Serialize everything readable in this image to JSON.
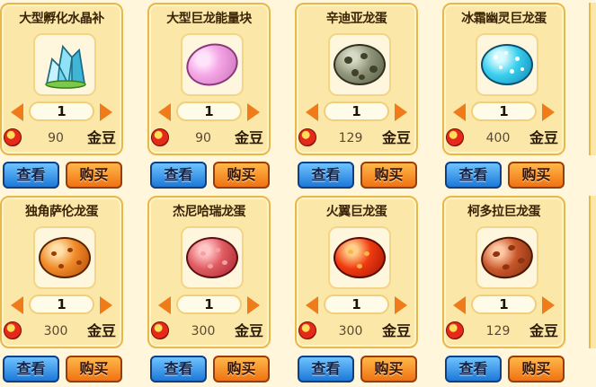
{
  "items": [
    {
      "name": "大型孵化水晶补",
      "qty": "1",
      "price": "90",
      "currency": "金豆",
      "view_label": "查看",
      "buy_label": "购买",
      "icon": "crystal-icon",
      "color": "#69d3e8"
    },
    {
      "name": "大型巨龙能量块",
      "qty": "1",
      "price": "90",
      "currency": "金豆",
      "view_label": "查看",
      "buy_label": "购买",
      "icon": "pink-energy-stone-icon",
      "color": "#f5a7e6"
    },
    {
      "name": "辛迪亚龙蛋",
      "qty": "1",
      "price": "129",
      "currency": "金豆",
      "view_label": "查看",
      "buy_label": "购买",
      "icon": "gray-spotted-egg-icon",
      "color": "#8f9479"
    },
    {
      "name": "冰霜幽灵巨龙蛋",
      "qty": "1",
      "price": "400",
      "currency": "金豆",
      "view_label": "查看",
      "buy_label": "购买",
      "icon": "cyan-spotted-egg-icon",
      "color": "#39cfee"
    },
    {
      "name": "独角萨伦龙蛋",
      "qty": "1",
      "price": "300",
      "currency": "金豆",
      "view_label": "查看",
      "buy_label": "购买",
      "icon": "orange-spotted-egg-icon",
      "color": "#f08a28"
    },
    {
      "name": "杰尼哈瑞龙蛋",
      "qty": "1",
      "price": "300",
      "currency": "金豆",
      "view_label": "查看",
      "buy_label": "购买",
      "icon": "red-spotted-egg-icon",
      "color": "#e05c62"
    },
    {
      "name": "火翼巨龙蛋",
      "qty": "1",
      "price": "300",
      "currency": "金豆",
      "view_label": "查看",
      "buy_label": "购买",
      "icon": "fire-red-egg-icon",
      "color": "#f03a10"
    },
    {
      "name": "柯多拉巨龙蛋",
      "qty": "1",
      "price": "129",
      "currency": "金豆",
      "view_label": "查看",
      "buy_label": "购买",
      "icon": "brown-spotted-egg-icon",
      "color": "#c8562a"
    }
  ]
}
